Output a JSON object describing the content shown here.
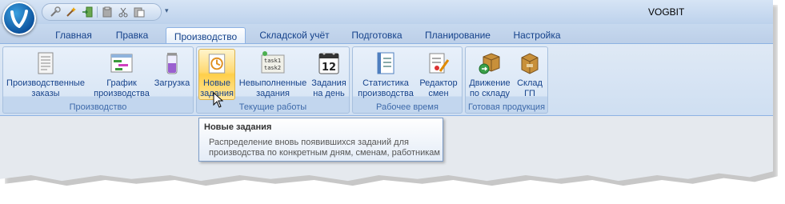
{
  "app": {
    "title": "VOGBIT"
  },
  "quick_access": {
    "icons": [
      "tools-icon",
      "wizard-icon",
      "exit-icon",
      "clipboard-icon",
      "scissors-icon",
      "paste-icon"
    ],
    "more_icon": "chevron-down-icon"
  },
  "tabs": [
    {
      "label": "Главная",
      "active": false
    },
    {
      "label": "Правка",
      "active": false
    },
    {
      "label": "Производство",
      "active": true
    },
    {
      "label": "Складской учёт",
      "active": false
    },
    {
      "label": "Подготовка",
      "active": false
    },
    {
      "label": "Планирование",
      "active": false
    },
    {
      "label": "Настройка",
      "active": false
    }
  ],
  "groups": [
    {
      "label": "Производство",
      "buttons": [
        {
          "label": "Производственные\nзаказы",
          "icon": "production-orders-icon"
        },
        {
          "label": "График\nпроизводства",
          "icon": "production-schedule-icon"
        },
        {
          "label": "Загрузка",
          "icon": "load-icon"
        }
      ]
    },
    {
      "label": "Текущие работы",
      "buttons": [
        {
          "label": "Новые\nзадания",
          "icon": "new-tasks-icon",
          "hovered": true
        },
        {
          "label": "Невыполненные\nзадания",
          "icon": "pending-tasks-icon"
        },
        {
          "label": "Задания\nна день",
          "icon": "calendar-icon"
        }
      ]
    },
    {
      "label": "Рабочее время",
      "buttons": [
        {
          "label": "Статистика\nпроизводства",
          "icon": "statistics-icon"
        },
        {
          "label": "Редактор\nсмен",
          "icon": "shift-editor-icon"
        }
      ]
    },
    {
      "label": "Готовая продукция",
      "buttons": [
        {
          "label": "Движение\nпо складу",
          "icon": "warehouse-movement-icon"
        },
        {
          "label": "Склад\nГП",
          "icon": "warehouse-icon"
        }
      ]
    }
  ],
  "calendar_day": "12",
  "task_icon_text": {
    "line1": "task1",
    "line2": "task2"
  },
  "tooltip": {
    "title": "Новые задания",
    "body": "Распределение вновь появившихся заданий для\nпроизводства по конкретным дням, сменам, работникам"
  },
  "colors": {
    "accent": "#15428b",
    "hover": "#ffd971",
    "ribbon": "#dfe9f5"
  }
}
